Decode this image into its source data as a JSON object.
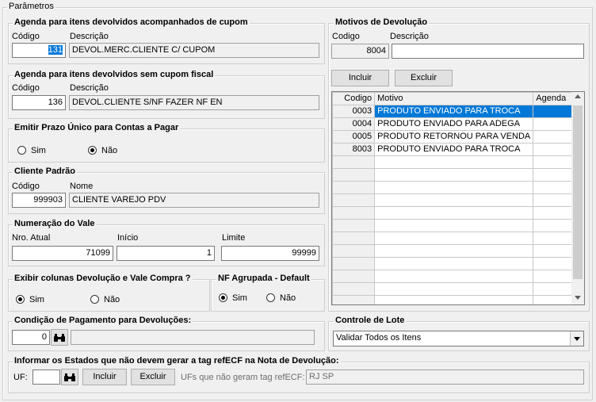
{
  "window_title": "Parâmetros",
  "agenda_com_cupom": {
    "title": "Agenda para itens devolvidos acompanhados de cupom",
    "code_label": "Código",
    "desc_label": "Descrição",
    "code": "131",
    "desc": "DEVOL.MERC.CLIENTE C/ CUPOM"
  },
  "agenda_sem_cupom": {
    "title": "Agenda para itens devolvidos sem cupom fiscal",
    "code_label": "Código",
    "desc_label": "Descrição",
    "code": "136",
    "desc": "DEVOL.CLIENTE S/NF FAZER NF EN"
  },
  "prazo_unico": {
    "title": "Emitir Prazo Único para Contas a Pagar",
    "opt_sim": "Sim",
    "opt_nao": "Não",
    "selected": "Não"
  },
  "cliente_padrao": {
    "title": "Cliente Padrão",
    "code_label": "Código",
    "name_label": "Nome",
    "code": "999903",
    "name": "CLIENTE VAREJO PDV"
  },
  "numeracao_vale": {
    "title": "Numeração do Vale",
    "atual_label": "Nro. Atual",
    "inicio_label": "Início",
    "limite_label": "Limite",
    "atual": "71099",
    "inicio": "1",
    "limite": "99999"
  },
  "exibir_colunas": {
    "title": "Exibir colunas Devolução e Vale Compra ?",
    "opt_sim": "Sim",
    "opt_nao": "Não",
    "selected": "Sim"
  },
  "nf_agrupada": {
    "title": "NF Agrupada - Default",
    "opt_sim": "Sim",
    "opt_nao": "Não",
    "selected": "Sim"
  },
  "condicao_pagamento": {
    "title": "Condição de Pagamento para Devoluções:",
    "code": "0",
    "search_icon": "binoculars-icon",
    "desc": ""
  },
  "motivos": {
    "title": "Motivos de Devolução",
    "code_label": "Codigo",
    "desc_label": "Descrição",
    "code": "8004",
    "desc": "",
    "incluir": "Incluir",
    "excluir": "Excluir",
    "columns": [
      "Codigo",
      "Motivo",
      "Agenda"
    ],
    "rows": [
      {
        "codigo": "0003",
        "motivo": "PRODUTO ENVIADO PARA TROCA",
        "agenda": ""
      },
      {
        "codigo": "0004",
        "motivo": "PRODUTO ENVIADO PARA ADEGA",
        "agenda": ""
      },
      {
        "codigo": "0005",
        "motivo": "PRODUTO RETORNOU PARA VENDA",
        "agenda": ""
      },
      {
        "codigo": "8003",
        "motivo": "PRODUTO ENVIADO PARA TROCA",
        "agenda": ""
      }
    ],
    "selected_row": 0
  },
  "controle_lote": {
    "title": "Controle de Lote",
    "value": "Validar Todos os Itens"
  },
  "ref_ecf": {
    "title": "Informar os Estados que não devem gerar a tag refECF na Nota de Devolução:",
    "uf_label": "UF:",
    "uf": "",
    "incluir": "Incluir",
    "excluir": "Excluir",
    "list_label": "UFs que não geram tag refECF:",
    "list_value": "RJ SP"
  }
}
